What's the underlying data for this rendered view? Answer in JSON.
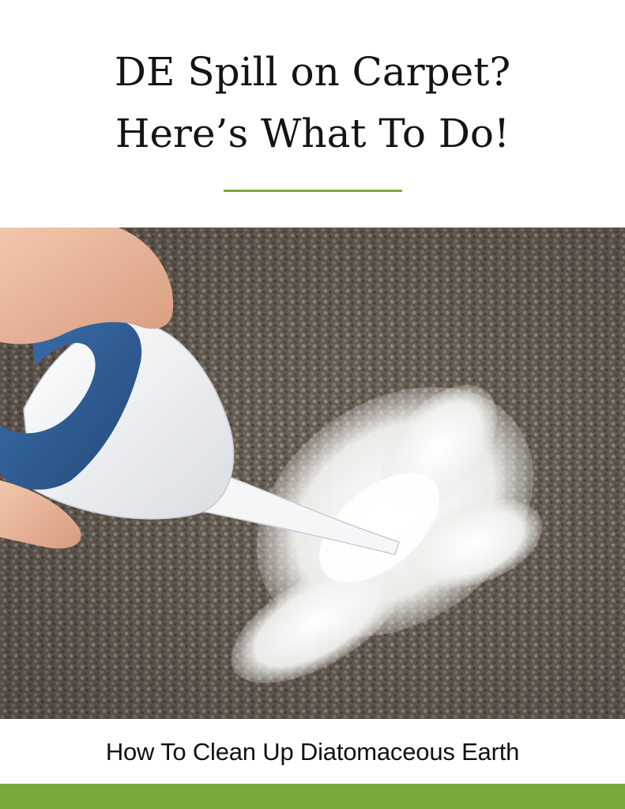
{
  "header": {
    "title_line1": "DE Spill on Carpet?",
    "title_line2": "Here’s What To Do!"
  },
  "caption": {
    "text": "How To Clean Up Diatomaceous Earth"
  },
  "colors": {
    "accent_green": "#7aa83a",
    "carpet": "#6f655b",
    "bottle_blue": "#2f5f99",
    "powder": "#f4f4f2"
  },
  "photo": {
    "subject_icon": "duster-bottle-icon"
  }
}
